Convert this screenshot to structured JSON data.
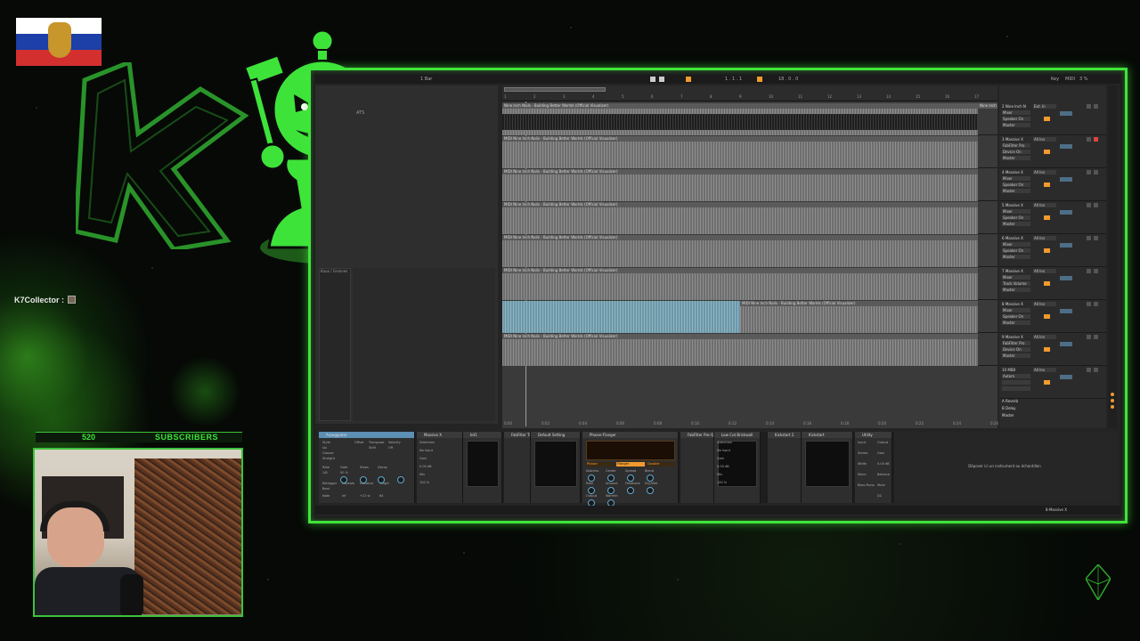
{
  "overlay": {
    "chat_username": "K7Collector :",
    "subscriber_count": "520",
    "subscriber_label": "SUBSCRIBERS",
    "flag_colors": [
      "#ffffff",
      "#1c3fa8",
      "#d32f2f"
    ],
    "accent_color": "#3fe43a"
  },
  "daw": {
    "transport": {
      "bar": "1 Bar",
      "position": "1 . 1 . 1",
      "tempo_display": "18 . 0 . 0",
      "key_label": "Key",
      "midi_label": "MIDI",
      "cpu": "3 %"
    },
    "browser": {
      "item": "ATS",
      "label": "Kaux / Grooves"
    },
    "ruler_ticks": [
      "1",
      "2",
      "3",
      "4",
      "5",
      "6",
      "7",
      "8",
      "9",
      "10",
      "11",
      "12",
      "13",
      "14",
      "15",
      "16",
      "17"
    ],
    "time_ticks": [
      "0:00",
      "0:02",
      "0:04",
      "0:06",
      "0:08",
      "0:10",
      "0:12",
      "0:14",
      "0:16",
      "0:18",
      "0:20",
      "0:22",
      "0:24",
      "0:26"
    ],
    "tracks": [
      {
        "clip": "Nine Inch Nails - Building Better Worlds (Official Visualizer)",
        "type": "audio",
        "trail": "Nine Inch N"
      },
      {
        "clip": "MIDI Nine Inch Nails - Building Better Worlds (Official Visualizer)",
        "type": "midi"
      },
      {
        "clip": "MIDI Nine Inch Nails - Building Better Worlds (Official Visualizer)",
        "type": "midi"
      },
      {
        "clip": "MIDI Nine Inch Nails - Building Better Worlds (Official Visualizer)",
        "type": "midi"
      },
      {
        "clip": "MIDI Nine Inch Nails - Building Better Worlds (Official Visualizer)",
        "type": "midi"
      },
      {
        "clip": "MIDI Nine Inch Nails - Building Better Worlds (Official Visualizer)",
        "type": "midi"
      },
      {
        "clip": "MIDI Nine Inch Nails - Building Better Worlds (Official Visualizer)",
        "type": "midi-blue"
      },
      {
        "clip": "MIDI Nine Inch Nails - Building Better Worlds (Official Visualizer)",
        "type": "midi"
      }
    ],
    "mixer": [
      {
        "name": "2 Nine Inch N",
        "in": "Ext. In",
        "dev": "Mixer",
        "out": "Speaker On",
        "route": "Master"
      },
      {
        "name": "3 Massive X",
        "in": "All Ins",
        "dev": "FabFilter Pro",
        "out": "Device On",
        "route": "Master"
      },
      {
        "name": "4 Massive X",
        "in": "All Ins",
        "dev": "Mixer",
        "out": "Speaker On",
        "route": "Master"
      },
      {
        "name": "5 Massive X",
        "in": "All Ins",
        "dev": "Mixer",
        "out": "Speaker On",
        "route": "Master"
      },
      {
        "name": "6 Massive X",
        "in": "All Ins",
        "dev": "Mixer",
        "out": "Speaker On",
        "route": "Master"
      },
      {
        "name": "7 Massive X",
        "in": "All Ins",
        "dev": "Mixer",
        "out": "Track Volume",
        "route": "Master"
      },
      {
        "name": "8 Massive X",
        "in": "All Ins",
        "dev": "Mixer",
        "out": "Speaker On",
        "route": "Master"
      },
      {
        "name": "9 Massive X",
        "in": "All Ins",
        "dev": "FabFilter Pro",
        "out": "Device On",
        "route": "Master"
      },
      {
        "name": "10 MIDI",
        "in": "All Ins",
        "dev": "Autom",
        "out": "",
        "route": ""
      }
    ],
    "returns": [
      "A Reverb",
      "B Delay",
      "Master"
    ],
    "devices": [
      {
        "title": "Arpeggiator",
        "selected": true
      },
      {
        "title": "Massive X",
        "selected": false
      },
      {
        "title": "bit1",
        "selected": false
      },
      {
        "title": "FabFilter Tim",
        "selected": false
      },
      {
        "title": "Default Setting",
        "selected": false
      },
      {
        "title": "Phaser-Flanger",
        "selected": false
      },
      {
        "title": "FabFilter Pro-Q 3",
        "selected": false
      },
      {
        "title": "Low Cut Brickwall",
        "selected": false
      },
      {
        "title": "Kickstart 2",
        "selected": false
      },
      {
        "title": "Kickstart",
        "selected": false
      },
      {
        "title": "Utility",
        "selected": false
      }
    ],
    "arp_params": [
      "Style",
      "Up",
      "Groove",
      "Straight",
      "Offset",
      "Transpose",
      "Shift",
      "Velocity",
      "Off",
      "Rate",
      "1/8",
      "Gate",
      "90 %",
      "Steps",
      "Decay",
      "Retrigger",
      "Beat",
      "Note",
      "Repeats",
      "Inf",
      "Distance",
      "+12 st",
      "Target",
      "64"
    ],
    "phaser_modes": [
      "Phaser",
      "Flanger",
      "Doubler"
    ],
    "phaser_params": [
      "Notches",
      "Center",
      "Spread",
      "Blend",
      "Rate",
      "Amount",
      "Feedback",
      "Dry/Wet",
      "Output",
      "Warmth"
    ],
    "sidechain_labels": [
      "Sidechain",
      "No Input",
      "Gain",
      "0.00 dB",
      "Mix",
      "100 %"
    ],
    "utility_params": [
      "Input",
      "Stereo",
      "Width",
      "Mono",
      "Bass Mono",
      "Output",
      "Gain",
      "0.00 dB",
      "Balance",
      "Mute",
      "DC"
    ],
    "drop_hint": "Déposer ici un instrument ou échantillon",
    "status_right": "8-Massive X"
  }
}
